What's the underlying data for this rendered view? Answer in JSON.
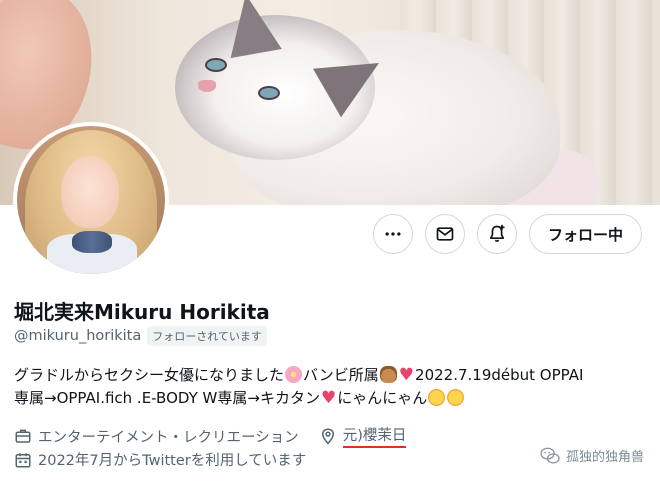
{
  "profile": {
    "display_name": "堀北実来Mikuru Horikita",
    "handle": "@mikuru_horikita",
    "follows_you_badge": "フォローされています",
    "bio_line1_a": "グラドルからセクシー女優になりました",
    "bio_line1_b": "バンビ所属",
    "bio_line1_c": "2022.7.19début OPPAI",
    "bio_line2_a": "専属→OPPAI.fich .E-BODY W専属→キカタン",
    "bio_line2_b": "にゃんにゃん",
    "heart_glyph": "♥",
    "category": "エンターテイメント・レクリエーション",
    "location": "元)櫻茉日",
    "joined": "2022年7月からTwitterを利用しています"
  },
  "actions": {
    "more_icon": "more-icon",
    "message_icon": "mail-icon",
    "notify_icon": "bell-plus-icon",
    "follow_label": "フォロー中"
  },
  "watermark": {
    "text": "孤独的独角兽",
    "icon": "wechat-icon"
  },
  "colors": {
    "text_primary": "#0f1419",
    "text_secondary": "#536471",
    "border": "#cfd9de",
    "location_underline": "#e0321d"
  }
}
